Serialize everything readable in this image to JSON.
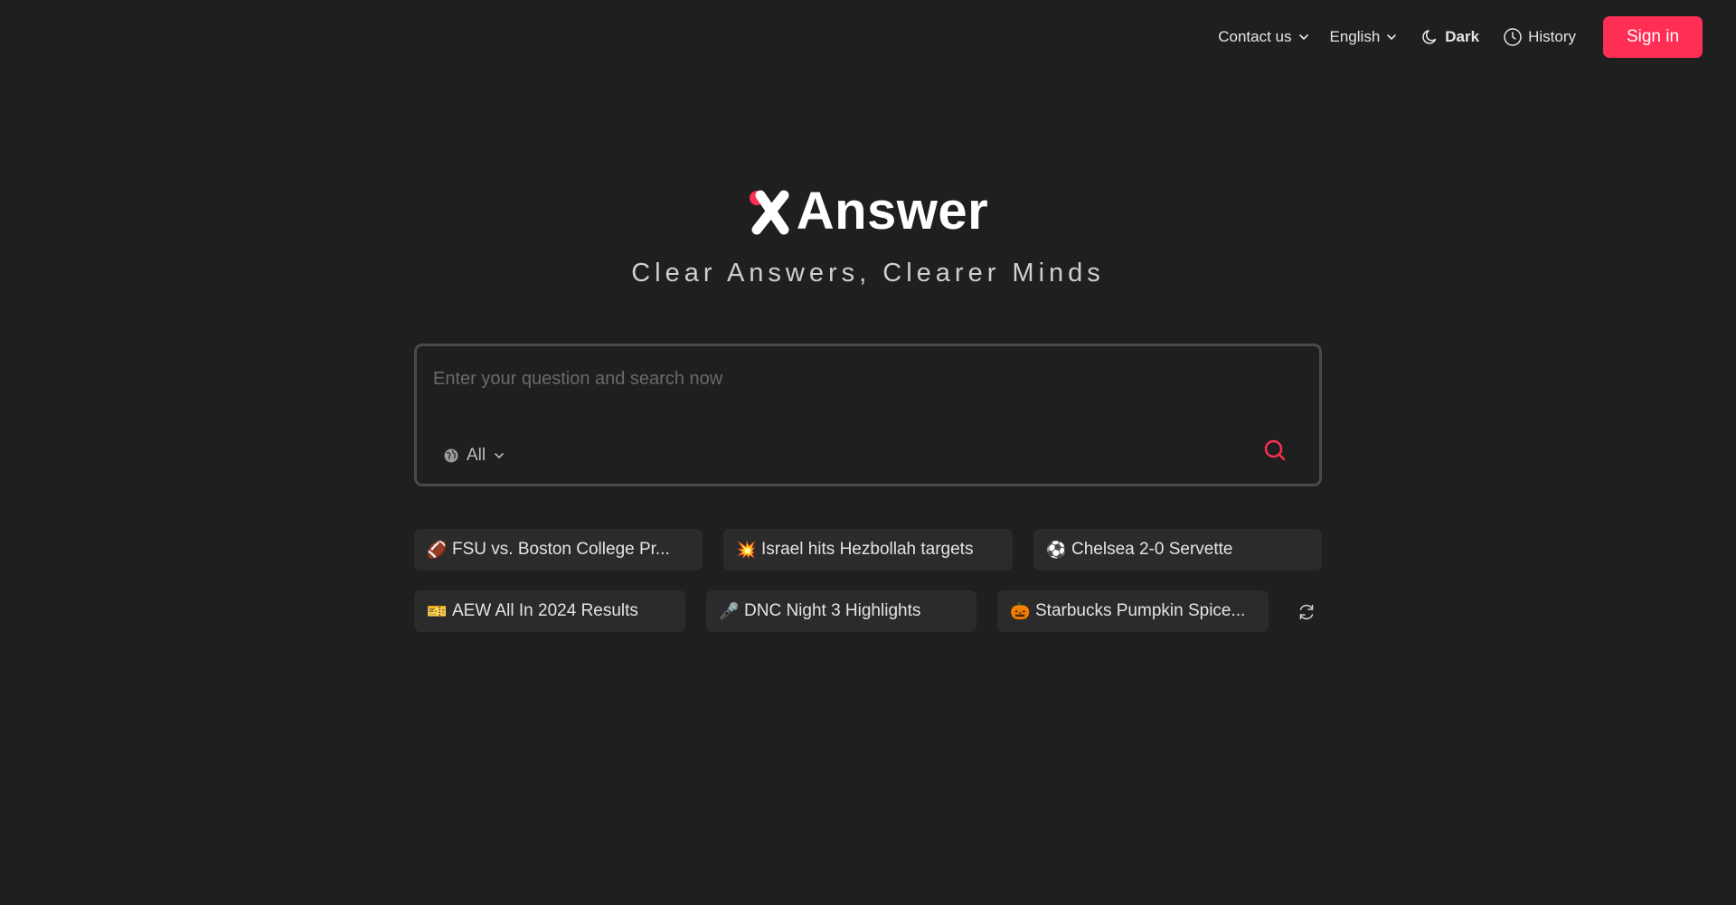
{
  "nav": {
    "contact_label": "Contact us",
    "language_label": "English",
    "theme_label": "Dark",
    "history_label": "History",
    "signin_label": "Sign in"
  },
  "brand": {
    "name": "Answer",
    "tagline": "Clear Answers, Clearer Minds",
    "accent": "#ff2e55"
  },
  "search": {
    "placeholder": "Enter your question and search now",
    "scope_label": "All"
  },
  "suggestions": [
    {
      "emoji": "🏈",
      "label": "FSU vs. Boston College Pr..."
    },
    {
      "emoji": "💥",
      "label": "Israel hits Hezbollah targets"
    },
    {
      "emoji": "⚽",
      "label": "Chelsea 2-0 Servette"
    },
    {
      "emoji": "🎫",
      "label": "AEW All In 2024 Results"
    },
    {
      "emoji": "🎤",
      "label": "DNC Night 3 Highlights"
    },
    {
      "emoji": "🎃",
      "label": "Starbucks Pumpkin Spice..."
    }
  ]
}
